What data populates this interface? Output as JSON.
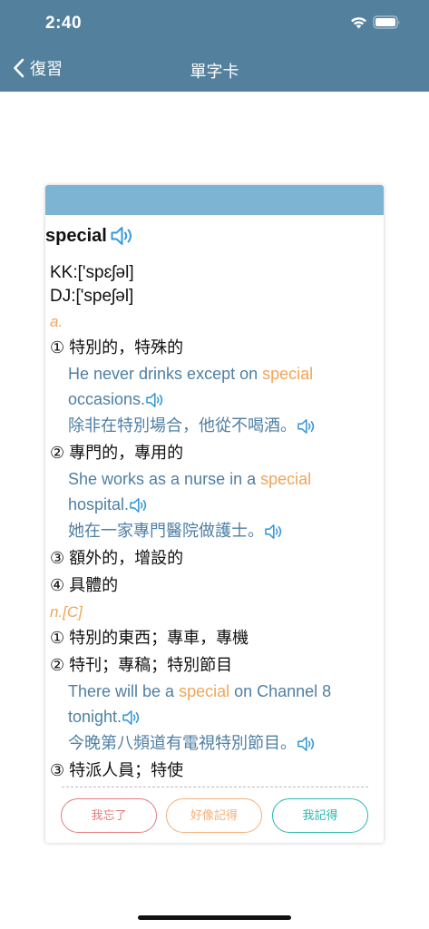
{
  "status_bar": {
    "time": "2:40"
  },
  "nav": {
    "back_label": "復習",
    "title": "單字卡"
  },
  "card": {
    "word": "special",
    "kk": "KK:['spɛʃəl]",
    "dj": "DJ:['speʃəl]",
    "pos1": "a.",
    "def1": "① 特別的，特殊的",
    "ex1_en_pre": "He never drinks except on ",
    "ex1_en_hl": "special",
    "ex1_en_post": " occasions.",
    "ex1_zh": "除非在特別場合，他從不喝酒。",
    "def2": "② 專門的，專用的",
    "ex2_en_pre": "She works as a nurse in a ",
    "ex2_en_hl": "special",
    "ex2_en_post": " hospital.",
    "ex2_zh": "她在一家專門醫院做護士。",
    "def3": "③ 額外的，增設的",
    "def4": "④ 具體的",
    "pos2": "n.[C]",
    "def5": "① 特別的東西；專車，專機",
    "def6": "② 特刊；專稿；特別節目",
    "ex3_en_pre": "There will be a ",
    "ex3_en_hl": "special",
    "ex3_en_post": " on Channel 8 tonight.",
    "ex3_zh": "今晚第八頻道有電視特別節目。",
    "def7": "③ 特派人員；特使"
  },
  "buttons": {
    "forgot": "我忘了",
    "maybe": "好像記得",
    "remember": "我記得"
  },
  "colors": {
    "nav_bg": "#53809d",
    "card_header": "#7db4d3",
    "example_text": "#4f7fa3",
    "highlight": "#f0a55a"
  }
}
